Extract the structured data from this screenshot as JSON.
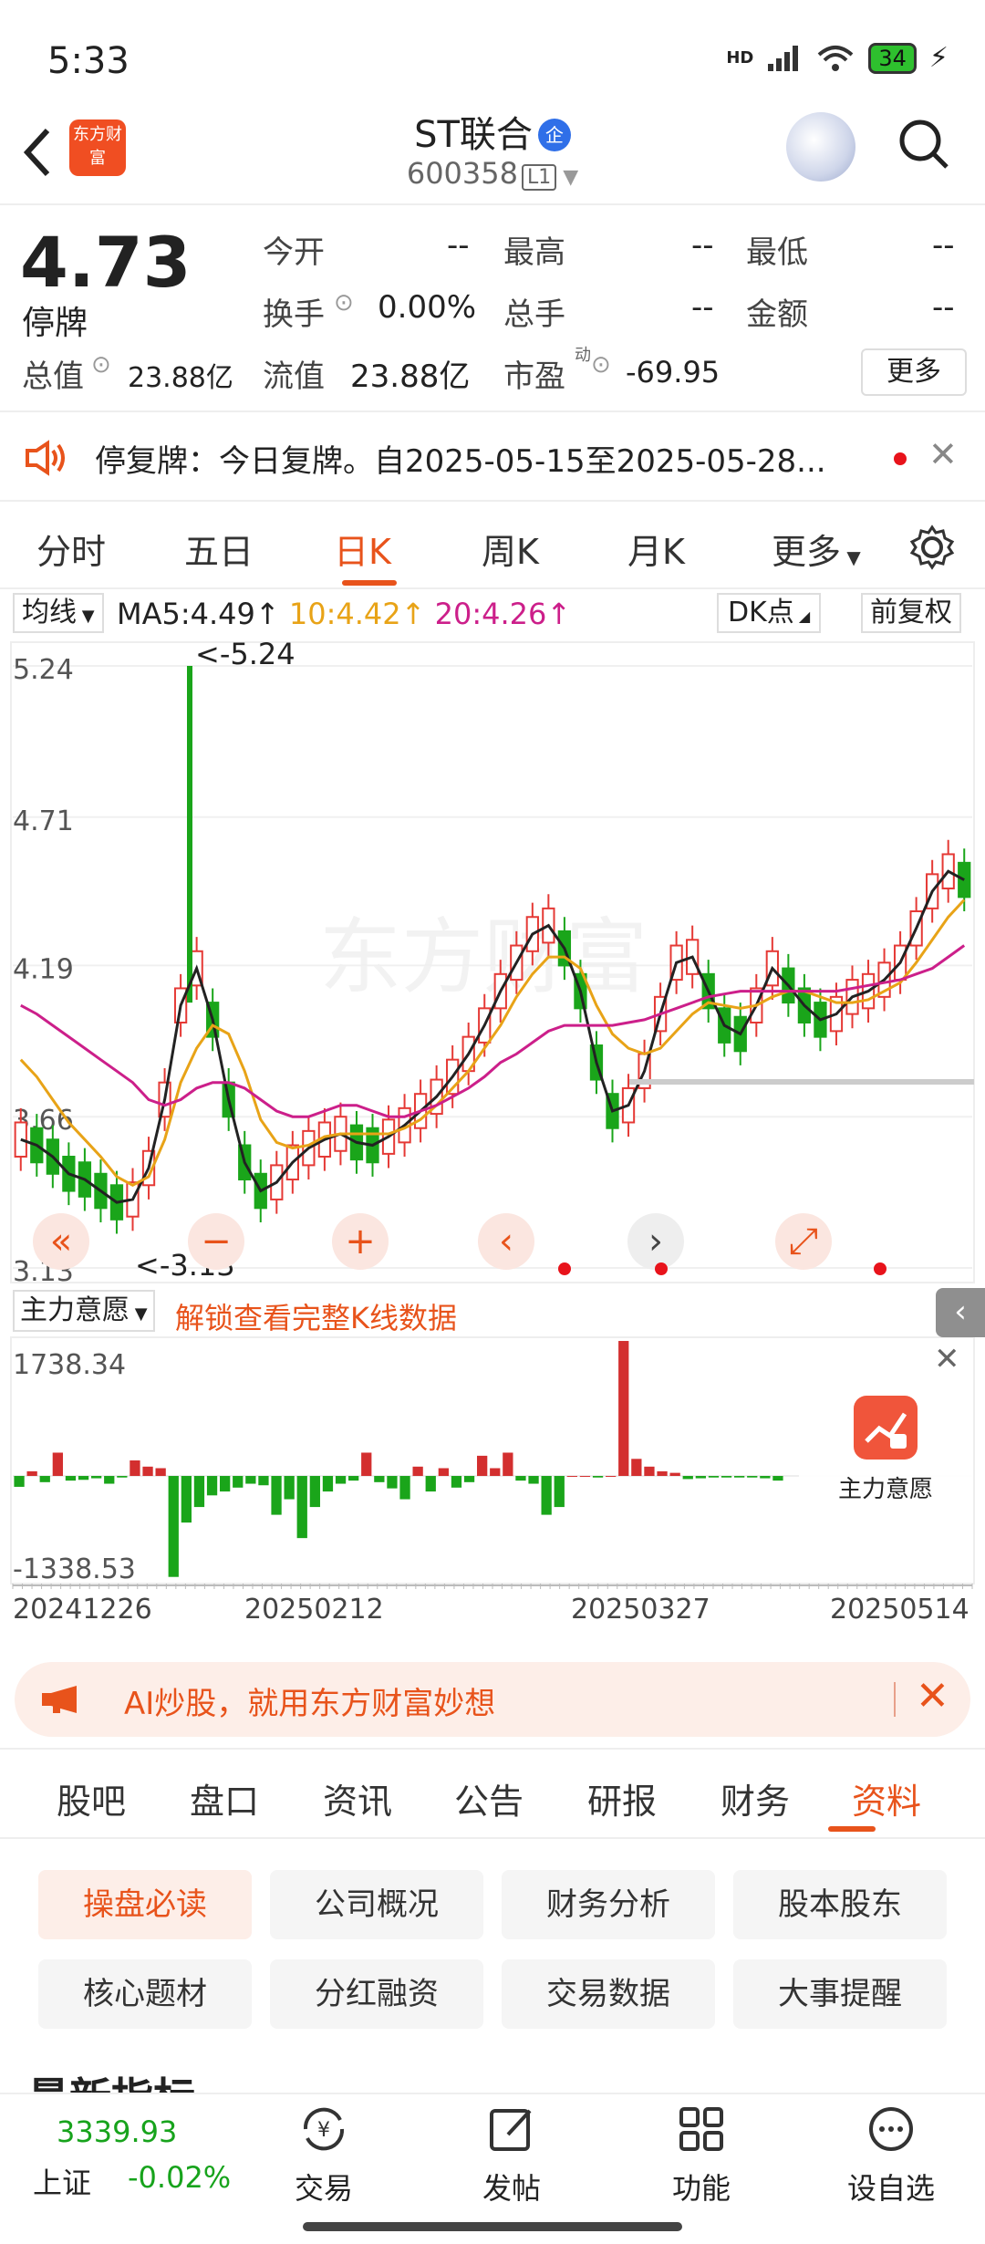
{
  "status_bar": {
    "time": "5:33",
    "network": "HD",
    "battery": "34"
  },
  "header": {
    "back_icon": "chevron-left-icon",
    "logo_text": "东方财富",
    "stock_name": "ST联合",
    "badge": "企",
    "stock_code": "600358",
    "level": "L1",
    "search_icon": "search-icon"
  },
  "quote": {
    "price": "4.73",
    "status": "停牌",
    "fields": [
      {
        "label": "今开",
        "value": "--"
      },
      {
        "label": "最高",
        "value": "--"
      },
      {
        "label": "最低",
        "value": "--"
      },
      {
        "label": "换手",
        "value": "0.00%"
      },
      {
        "label": "总手",
        "value": "--"
      },
      {
        "label": "金额",
        "value": "--"
      },
      {
        "label": "总值",
        "value": "23.88亿"
      },
      {
        "label": "流值",
        "value": "23.88亿"
      },
      {
        "label": "市盈",
        "value": "-69.95"
      }
    ],
    "pe_sup": "动",
    "more_label": "更多"
  },
  "notice": {
    "text": "停复牌：今日复牌。自2025-05-15至2025-05-28..."
  },
  "chart_tabs": [
    "分时",
    "五日",
    "日K",
    "周K",
    "月K",
    "更多"
  ],
  "chart_tab_active": 2,
  "ma_bar": {
    "selector": "均线",
    "ma5": "MA5:4.49↑",
    "ma10": "10:4.42↑",
    "ma20": "20:4.26↑",
    "dk": "DK点",
    "adjust": "前复权",
    "colors": {
      "ma5": "#222222",
      "ma10": "#e8a317",
      "ma20": "#cc1f8a"
    }
  },
  "indicator_bar": {
    "selector": "主力意愿",
    "unlock_text": "解锁查看完整K线数据",
    "panel_label": "主力意愿"
  },
  "ai_banner": {
    "text": "AI炒股，就用东方财富妙想"
  },
  "func_tabs": [
    "股吧",
    "盘口",
    "资讯",
    "公告",
    "研报",
    "财务",
    "资料"
  ],
  "func_tab_active": 6,
  "info_chips": [
    "操盘必读",
    "公司概况",
    "财务分析",
    "股本股东",
    "核心题材",
    "分红融资",
    "交易数据",
    "大事提醒"
  ],
  "partial_heading": "最新指标",
  "bottom_nav": {
    "index_value": "3339.93",
    "index_name": "上证",
    "index_change": "-0.02%",
    "items": [
      {
        "label": "交易",
        "icon": "yuan-exchange-icon"
      },
      {
        "label": "发帖",
        "icon": "edit-post-icon"
      },
      {
        "label": "功能",
        "icon": "grid-apps-icon"
      },
      {
        "label": "设自选",
        "icon": "more-circle-icon"
      }
    ]
  },
  "chart_data": [
    {
      "type": "candlestick",
      "y_labels": [
        "5.24",
        "4.71",
        "4.19",
        "3.66",
        "3.13"
      ],
      "ylim": [
        3.13,
        5.24
      ],
      "x_labels": [
        "20241226",
        "20250212",
        "20250327",
        "20250514"
      ],
      "annotations": [
        "<-5.24",
        "<-3.13"
      ],
      "series": [
        {
          "name": "MA5",
          "values": [
            3.58,
            3.56,
            3.52,
            3.46,
            3.44,
            3.4,
            3.36,
            3.37,
            3.48,
            3.72,
            4.05,
            4.18,
            4.0,
            3.72,
            3.5,
            3.4,
            3.43,
            3.5,
            3.55,
            3.58,
            3.6,
            3.57,
            3.56,
            3.59,
            3.63,
            3.68,
            3.73,
            3.8,
            3.88,
            3.98,
            4.1,
            4.2,
            4.3,
            4.33,
            4.25,
            4.1,
            3.85,
            3.68,
            3.7,
            3.82,
            4.02,
            4.2,
            4.22,
            4.1,
            3.98,
            3.95,
            4.05,
            4.18,
            4.12,
            4.05,
            4.0,
            4.02,
            4.08,
            4.1,
            4.14,
            4.2,
            4.32,
            4.45,
            4.52,
            4.49
          ]
        },
        {
          "name": "MA10",
          "values": [
            3.86,
            3.8,
            3.72,
            3.64,
            3.58,
            3.52,
            3.45,
            3.42,
            3.45,
            3.58,
            3.78,
            3.9,
            3.98,
            3.95,
            3.82,
            3.65,
            3.57,
            3.55,
            3.56,
            3.59,
            3.6,
            3.6,
            3.6,
            3.6,
            3.62,
            3.65,
            3.7,
            3.76,
            3.82,
            3.9,
            3.98,
            4.08,
            4.16,
            4.22,
            4.22,
            4.18,
            4.05,
            3.95,
            3.9,
            3.88,
            3.9,
            3.96,
            4.02,
            4.06,
            4.05,
            4.04,
            4.05,
            4.08,
            4.1,
            4.1,
            4.08,
            4.06,
            4.06,
            4.07,
            4.1,
            4.13,
            4.2,
            4.28,
            4.36,
            4.42
          ]
        },
        {
          "name": "MA20",
          "values": [
            4.05,
            4.02,
            3.98,
            3.94,
            3.9,
            3.86,
            3.82,
            3.78,
            3.72,
            3.7,
            3.72,
            3.76,
            3.78,
            3.78,
            3.76,
            3.72,
            3.68,
            3.66,
            3.66,
            3.68,
            3.7,
            3.7,
            3.68,
            3.66,
            3.66,
            3.68,
            3.7,
            3.73,
            3.76,
            3.8,
            3.85,
            3.88,
            3.92,
            3.96,
            3.98,
            3.98,
            3.98,
            3.98,
            3.99,
            4.0,
            4.02,
            4.04,
            4.06,
            4.08,
            4.09,
            4.1,
            4.1,
            4.1,
            4.1,
            4.1,
            4.1,
            4.1,
            4.11,
            4.12,
            4.13,
            4.14,
            4.16,
            4.18,
            4.22,
            4.26
          ]
        }
      ]
    },
    {
      "type": "bar",
      "name": "主力意愿",
      "y_labels": [
        "1738.34",
        "-1338.53"
      ],
      "ylim": [
        -1338.53,
        1738.34
      ],
      "values": [
        -140,
        60,
        -80,
        300,
        -60,
        -50,
        -30,
        -100,
        -20,
        200,
        120,
        100,
        -1300,
        -600,
        -400,
        -250,
        -200,
        -150,
        -100,
        -120,
        -500,
        -300,
        -800,
        -400,
        -200,
        -100,
        -60,
        300,
        -80,
        -160,
        -300,
        120,
        -200,
        100,
        -150,
        -80,
        260,
        100,
        300,
        -60,
        -100,
        -500,
        -400,
        0,
        0,
        -20,
        0,
        1738,
        220,
        120,
        60,
        40,
        -40,
        -30,
        -20,
        -20,
        -20,
        -20,
        -30,
        -60
      ]
    }
  ]
}
